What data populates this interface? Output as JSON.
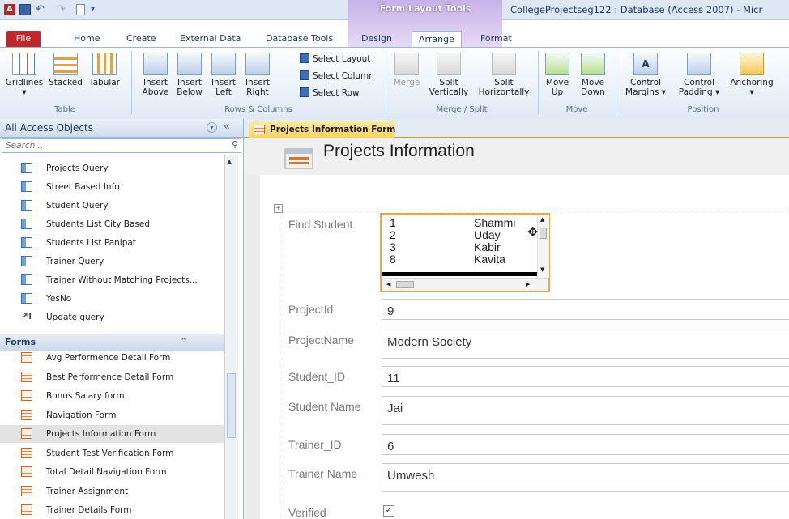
{
  "window": {
    "title": "CollegeProjectseg122 : Database (Access 2007) - Micr",
    "context_tools": "Form Layout Tools"
  },
  "tabs": [
    {
      "label": "File"
    },
    {
      "label": "Home"
    },
    {
      "label": "Create"
    },
    {
      "label": "External Data"
    },
    {
      "label": "Database Tools"
    },
    {
      "label": "Design"
    },
    {
      "label": "Arrange"
    },
    {
      "label": "Format"
    }
  ],
  "ribbon": {
    "table": {
      "label": "Table",
      "gridlines": "Gridlines",
      "stacked": "Stacked",
      "tabular": "Tabular"
    },
    "rows_columns": {
      "label": "Rows & Columns",
      "insert_above_1": "Insert",
      "insert_above_2": "Above",
      "insert_below_1": "Insert",
      "insert_below_2": "Below",
      "insert_left_1": "Insert",
      "insert_left_2": "Left",
      "insert_right_1": "Insert",
      "insert_right_2": "Right",
      "select_layout": "Select Layout",
      "select_column": "Select Column",
      "select_row": "Select Row"
    },
    "merge_split": {
      "label": "Merge / Split",
      "merge": "Merge",
      "split_v_1": "Split",
      "split_v_2": "Vertically",
      "split_h_1": "Split",
      "split_h_2": "Horizontally"
    },
    "move": {
      "label": "Move",
      "up_1": "Move",
      "up_2": "Up",
      "down_1": "Move",
      "down_2": "Down"
    },
    "position": {
      "label": "Position",
      "margins_1": "Control",
      "margins_2": "Margins ▾",
      "padding_1": "Control",
      "padding_2": "Padding ▾",
      "anchoring": "Anchoring"
    }
  },
  "nav": {
    "title": "All Access Objects",
    "search_placeholder": "Search...",
    "queries": [
      {
        "label": "Projects Query",
        "icon": "query-icon"
      },
      {
        "label": "Street Based Info",
        "icon": "query-icon"
      },
      {
        "label": "Student Query",
        "icon": "query-icon"
      },
      {
        "label": "Students List City Based",
        "icon": "query-icon"
      },
      {
        "label": "Students List Panipat",
        "icon": "query-icon"
      },
      {
        "label": "Trainer Query",
        "icon": "query-icon"
      },
      {
        "label": "Trainer Without Matching Projects...",
        "icon": "query-icon"
      },
      {
        "label": "YesNo",
        "icon": "query-icon"
      },
      {
        "label": "Update query",
        "icon": "action-query-icon"
      }
    ],
    "forms_header": "Forms",
    "forms": [
      {
        "label": "Avg Performence Detail Form"
      },
      {
        "label": "Best Performence Detail Form"
      },
      {
        "label": "Bonus Salary form"
      },
      {
        "label": "Navigation Form"
      },
      {
        "label": "Projects Information Form",
        "selected": true
      },
      {
        "label": "Student Test Verification Form"
      },
      {
        "label": "Total Detail Navigation Form"
      },
      {
        "label": "Trainer Assignment"
      },
      {
        "label": "Trainer Details Form"
      }
    ]
  },
  "document": {
    "tab_label": "Projects Information Form",
    "form_title": "Projects Information",
    "find_student_label": "Find Student",
    "listbox_rows": [
      {
        "id": "1",
        "name": "Shammi"
      },
      {
        "id": "2",
        "name": "Uday"
      },
      {
        "id": "3",
        "name": "Kabir"
      },
      {
        "id": "8",
        "name": "Kavita"
      }
    ],
    "fields": [
      {
        "label": "ProjectId",
        "value": "9"
      },
      {
        "label": "ProjectName",
        "value": "Modern Society"
      },
      {
        "label": "Student_ID",
        "value": "11"
      },
      {
        "label": "Student Name",
        "value": "Jai"
      },
      {
        "label": "Trainer_ID",
        "value": "6"
      },
      {
        "label": "Trainer Name",
        "value": "Umwesh"
      },
      {
        "label": "Verified",
        "value": "✓"
      }
    ]
  }
}
